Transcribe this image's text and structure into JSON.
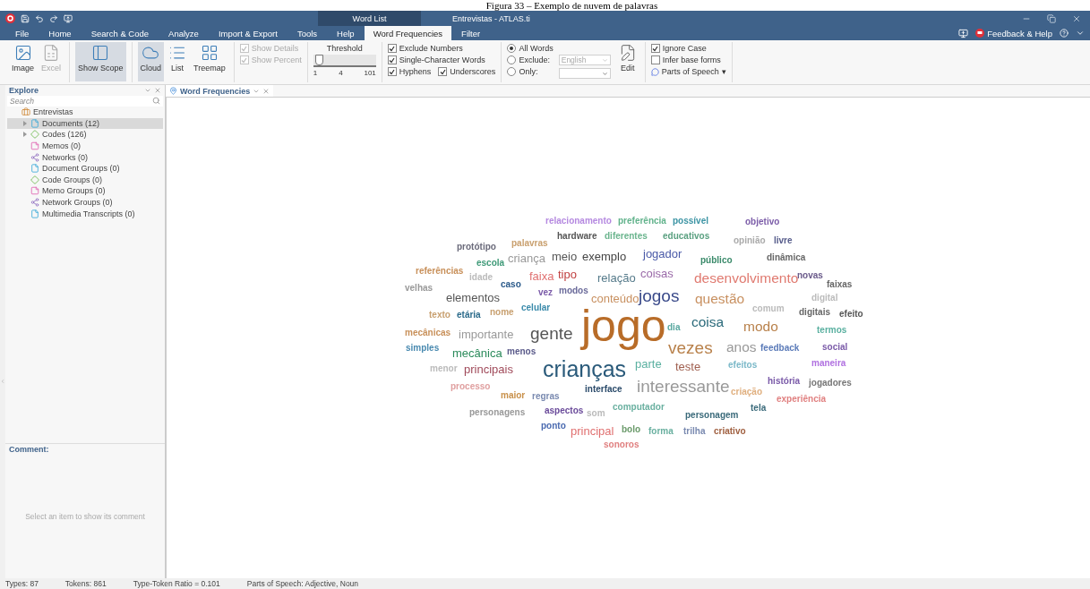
{
  "caption": "Figura 33 – Exemplo de nuvem de palavras",
  "window": {
    "title": "Entrevistas - ATLAS.ti",
    "context_tab": "Word List"
  },
  "menu_tabs": [
    {
      "label": "File",
      "selected": false
    },
    {
      "label": "Home",
      "selected": false
    },
    {
      "label": "Search & Code",
      "selected": false
    },
    {
      "label": "Analyze",
      "selected": false
    },
    {
      "label": "Import & Export",
      "selected": false
    },
    {
      "label": "Tools",
      "selected": false
    },
    {
      "label": "Help",
      "selected": false
    },
    {
      "label": "Word Frequencies",
      "selected": true
    },
    {
      "label": "Filter",
      "selected": false
    }
  ],
  "help": {
    "label": "Feedback & Help"
  },
  "ribbon": {
    "export_buttons": [
      {
        "label": "Image",
        "kind": "image",
        "disabled": false
      },
      {
        "label": "Excel",
        "kind": "excel",
        "disabled": true
      }
    ],
    "scope_button": {
      "label": "Show Scope",
      "selected": true
    },
    "view_buttons": [
      {
        "label": "Cloud",
        "kind": "cloud",
        "selected": true
      },
      {
        "label": "List",
        "kind": "list",
        "selected": false
      },
      {
        "label": "Treemap",
        "kind": "treemap",
        "selected": false
      }
    ],
    "display_options": [
      {
        "label": "Show Details",
        "checked": true,
        "disabled": true
      },
      {
        "label": "Show Percent",
        "checked": true,
        "disabled": true
      }
    ],
    "threshold": {
      "label": "Threshold",
      "level": 0.03,
      "ticks": [
        "1",
        "4",
        "101"
      ]
    },
    "filters": [
      {
        "label": "Exclude Numbers",
        "checked": true
      },
      {
        "label": "Single-Character Words",
        "checked": true
      },
      {
        "label": "Hyphens",
        "checked": true
      },
      {
        "label": "Underscores",
        "checked": true
      }
    ],
    "word_scope": [
      {
        "label": "All Words",
        "selected": true
      },
      {
        "label": "Exclude:",
        "selected": false
      },
      {
        "label": "Only:",
        "selected": false
      }
    ],
    "language": {
      "value": "English",
      "disabled": true
    },
    "edit": {
      "label": "Edit"
    },
    "case_options": [
      {
        "label": "Ignore Case",
        "checked": true
      },
      {
        "label": "Infer base forms",
        "checked": false
      }
    ],
    "parts_of_speech": {
      "label": "Parts of Speech",
      "caret": "▾"
    }
  },
  "explore": {
    "title": "Explore",
    "search_placeholder": "Search",
    "tree": [
      {
        "label": "Entrevistas",
        "kind": "project",
        "expandable": false,
        "selected": false,
        "children": [
          {
            "label": "Documents (12)",
            "kind": "document",
            "expandable": true,
            "selected": true
          },
          {
            "label": "Codes (126)",
            "kind": "code",
            "expandable": true,
            "selected": false
          },
          {
            "label": "Memos (0)",
            "kind": "memo",
            "expandable": false,
            "selected": false
          },
          {
            "label": "Networks (0)",
            "kind": "network",
            "expandable": false,
            "selected": false
          },
          {
            "label": "Document Groups (0)",
            "kind": "document",
            "expandable": false,
            "selected": false
          },
          {
            "label": "Code Groups (0)",
            "kind": "code",
            "expandable": false,
            "selected": false
          },
          {
            "label": "Memo Groups (0)",
            "kind": "memo",
            "expandable": false,
            "selected": false
          },
          {
            "label": "Network Groups (0)",
            "kind": "network",
            "expandable": false,
            "selected": false
          },
          {
            "label": "Multimedia Transcripts (0)",
            "kind": "transcript",
            "expandable": false,
            "selected": false
          }
        ]
      }
    ]
  },
  "comment": {
    "title": "Comment:",
    "placeholder": "Select an item to show its comment"
  },
  "document_tab": {
    "label": "Word Frequencies",
    "selected": true
  },
  "cloud": [
    {
      "text": "relacionamento",
      "color": "#b589e0",
      "kind": "s"
    },
    {
      "text": "preferência",
      "color": "#62b38c",
      "kind": "s"
    },
    {
      "text": "possível",
      "color": "#3c94a4",
      "kind": "s"
    },
    {
      "text": "objetivo",
      "color": "#7b5ca8",
      "kind": "s"
    },
    {
      "text": "protótipo",
      "color": "#6a6a7a",
      "kind": "s"
    },
    {
      "text": "palavras",
      "color": "#c9a06f",
      "kind": "s"
    },
    {
      "text": "hardware",
      "color": "#555555",
      "kind": "s"
    },
    {
      "text": "diferentes",
      "color": "#6bb58e",
      "kind": "s"
    },
    {
      "text": "educativos",
      "color": "#5aa080",
      "kind": "s"
    },
    {
      "text": "opinião",
      "color": "#aaaaaa",
      "kind": "s"
    },
    {
      "text": "livre",
      "color": "#555b8a",
      "kind": "s"
    },
    {
      "text": "escola",
      "color": "#3f9a78",
      "kind": "s"
    },
    {
      "text": "criança",
      "color": "#999999",
      "kind": "m"
    },
    {
      "text": "meio",
      "color": "#555555",
      "kind": "m"
    },
    {
      "text": "exemplo",
      "color": "#444444",
      "kind": "m"
    },
    {
      "text": "jogador",
      "color": "#4a5aa8",
      "kind": "m"
    },
    {
      "text": "público",
      "color": "#3a8a6a",
      "kind": "s"
    },
    {
      "text": "dinâmica",
      "color": "#666666",
      "kind": "s"
    },
    {
      "text": "referências",
      "color": "#c8905a",
      "kind": "s"
    },
    {
      "text": "idade",
      "color": "#bbbbbb",
      "kind": "s"
    },
    {
      "text": "caso",
      "color": "#2a5a8a",
      "kind": "s"
    },
    {
      "text": "faixa",
      "color": "#e07070",
      "kind": "m"
    },
    {
      "text": "tipo",
      "color": "#c04040",
      "kind": "m"
    },
    {
      "text": "relação",
      "color": "#557a8a",
      "kind": "m"
    },
    {
      "text": "coisas",
      "color": "#9a6aa8",
      "kind": "m"
    },
    {
      "text": "desenvolvimento",
      "color": "#e07a70",
      "kind": "l"
    },
    {
      "text": "novas",
      "color": "#6a5a8a",
      "kind": "s"
    },
    {
      "text": "faixas",
      "color": "#666666",
      "kind": "s"
    },
    {
      "text": "velhas",
      "color": "#999999",
      "kind": "s"
    },
    {
      "text": "elementos",
      "color": "#555555",
      "kind": "m"
    },
    {
      "text": "vez",
      "color": "#7a5aa8",
      "kind": "s"
    },
    {
      "text": "modos",
      "color": "#6a6a9a",
      "kind": "s"
    },
    {
      "text": "conteúdo",
      "color": "#c89060",
      "kind": "m"
    },
    {
      "text": "jogos",
      "color": "#3a4a8a",
      "kind": "xl"
    },
    {
      "text": "questão",
      "color": "#c89060",
      "kind": "l"
    },
    {
      "text": "digital",
      "color": "#bbbbbb",
      "kind": "s"
    },
    {
      "text": "texto",
      "color": "#c8a070",
      "kind": "s"
    },
    {
      "text": "etária",
      "color": "#2a6a8a",
      "kind": "s"
    },
    {
      "text": "nome",
      "color": "#c8a070",
      "kind": "s"
    },
    {
      "text": "celular",
      "color": "#3a8aaa",
      "kind": "s"
    },
    {
      "text": "comum",
      "color": "#bbbbbb",
      "kind": "s"
    },
    {
      "text": "digitais",
      "color": "#666666",
      "kind": "s"
    },
    {
      "text": "efeito",
      "color": "#555555",
      "kind": "s"
    },
    {
      "text": "mecânicas",
      "color": "#c8905a",
      "kind": "s"
    },
    {
      "text": "importante",
      "color": "#999999",
      "kind": "m"
    },
    {
      "text": "gente",
      "color": "#555555",
      "kind": "xl"
    },
    {
      "text": "jogo",
      "color": "#b86c28",
      "kind": "huge"
    },
    {
      "text": "dia",
      "color": "#5aa8a0",
      "kind": "s"
    },
    {
      "text": "coisa",
      "color": "#2a6a7a",
      "kind": "l"
    },
    {
      "text": "modo",
      "color": "#b8804a",
      "kind": "l"
    },
    {
      "text": "termos",
      "color": "#5ab0a0",
      "kind": "s"
    },
    {
      "text": "simples",
      "color": "#4a8ab0",
      "kind": "s"
    },
    {
      "text": "mecânica",
      "color": "#2a8a5a",
      "kind": "m"
    },
    {
      "text": "menos",
      "color": "#5a5a8a",
      "kind": "s"
    },
    {
      "text": "vezes",
      "color": "#b8804a",
      "kind": "xl"
    },
    {
      "text": "anos",
      "color": "#999999",
      "kind": "l"
    },
    {
      "text": "feedback",
      "color": "#5a7ab8",
      "kind": "s"
    },
    {
      "text": "social",
      "color": "#7a5aa8",
      "kind": "s"
    },
    {
      "text": "menor",
      "color": "#bbbbbb",
      "kind": "s"
    },
    {
      "text": "principais",
      "color": "#a04a5a",
      "kind": "m"
    },
    {
      "text": "crianças",
      "color": "#2a5a7a",
      "kind": "xxl"
    },
    {
      "text": "parte",
      "color": "#5ab0a0",
      "kind": "m"
    },
    {
      "text": "teste",
      "color": "#a06050",
      "kind": "m"
    },
    {
      "text": "efeitos",
      "color": "#7ab8c8",
      "kind": "s"
    },
    {
      "text": "maneira",
      "color": "#b070e0",
      "kind": "s"
    },
    {
      "text": "processo",
      "color": "#e0a0a0",
      "kind": "s"
    },
    {
      "text": "interface",
      "color": "#2a4a6a",
      "kind": "s"
    },
    {
      "text": "interessante",
      "color": "#999999",
      "kind": "xl"
    },
    {
      "text": "história",
      "color": "#7a5aa8",
      "kind": "s"
    },
    {
      "text": "jogadores",
      "color": "#777777",
      "kind": "s"
    },
    {
      "text": "maior",
      "color": "#c8904a",
      "kind": "s"
    },
    {
      "text": "regras",
      "color": "#7a8ab0",
      "kind": "s"
    },
    {
      "text": "criação",
      "color": "#e0b080",
      "kind": "s"
    },
    {
      "text": "experiência",
      "color": "#e08080",
      "kind": "s"
    },
    {
      "text": "personagens",
      "color": "#999999",
      "kind": "s"
    },
    {
      "text": "aspectos",
      "color": "#6a4a9a",
      "kind": "s"
    },
    {
      "text": "som",
      "color": "#bbbbbb",
      "kind": "s"
    },
    {
      "text": "computador",
      "color": "#6ab0a0",
      "kind": "s"
    },
    {
      "text": "personagem",
      "color": "#3a6a7a",
      "kind": "s"
    },
    {
      "text": "tela",
      "color": "#3a6a7a",
      "kind": "s"
    },
    {
      "text": "ponto",
      "color": "#4a6ab0",
      "kind": "s"
    },
    {
      "text": "principal",
      "color": "#e07070",
      "kind": "m"
    },
    {
      "text": "bolo",
      "color": "#6a9a6a",
      "kind": "s"
    },
    {
      "text": "forma",
      "color": "#6ab0a0",
      "kind": "s"
    },
    {
      "text": "trilha",
      "color": "#7a8ab0",
      "kind": "s"
    },
    {
      "text": "criativo",
      "color": "#a06040",
      "kind": "s"
    },
    {
      "text": "sonoros",
      "color": "#e08080",
      "kind": "s"
    }
  ],
  "status_bar": [
    "Types: 87",
    "Tokens: 861",
    "Type-Token Ratio = 0.101",
    "Parts of Speech: Adjective, Noun"
  ]
}
